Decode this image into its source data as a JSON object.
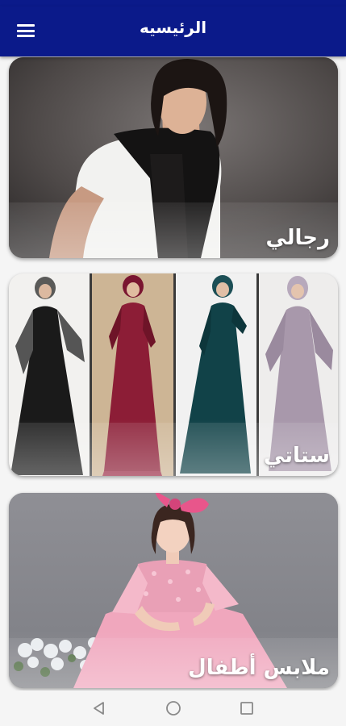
{
  "app_bar": {
    "title": "الرئيسيه",
    "menu_icon": "hamburger-menu-icon",
    "background": "#0b1a8a"
  },
  "categories": [
    {
      "label": "رجالي",
      "image": "man-in-white-tshirt-black-scarf"
    },
    {
      "label": "ستاتي",
      "image": "women-in-long-dresses-and-hijabs"
    },
    {
      "label": "ملابس أطفال",
      "image": "girl-in-pink-dress-with-hair-bow"
    }
  ],
  "nav_bar": {
    "back_icon": "back-triangle-icon",
    "home_icon": "home-circle-icon",
    "recent_icon": "recent-apps-square-icon"
  }
}
